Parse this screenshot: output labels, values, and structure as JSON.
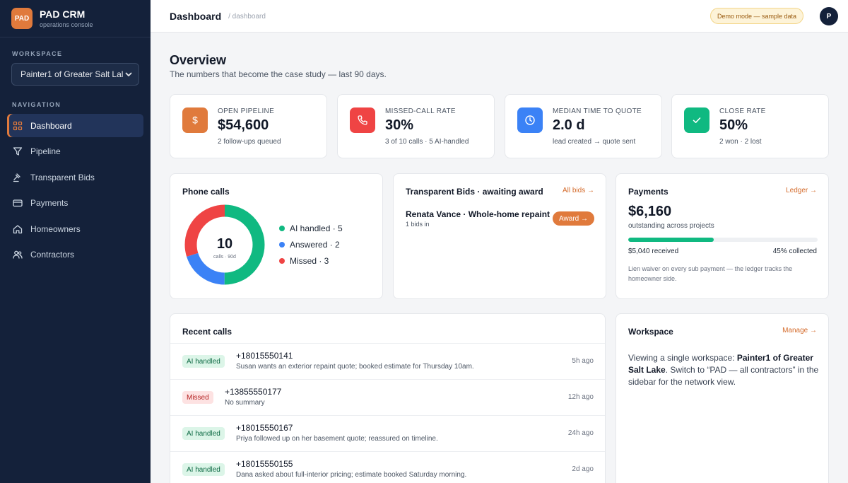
{
  "brand": {
    "logo": "PAD",
    "name": "PAD CRM",
    "subtitle": "operations console"
  },
  "sidebar": {
    "workspace_label": "WORKSPACE",
    "workspace_value": "Painter1 of Greater Salt Lal",
    "nav_label": "NAVIGATION",
    "items": [
      {
        "label": "Dashboard",
        "icon": "grid-icon",
        "active": true
      },
      {
        "label": "Pipeline",
        "icon": "funnel-icon"
      },
      {
        "label": "Transparent Bids",
        "icon": "gavel-icon"
      },
      {
        "label": "Payments",
        "icon": "credit-card-icon"
      },
      {
        "label": "Homeowners",
        "icon": "home-icon"
      },
      {
        "label": "Contractors",
        "icon": "users-icon"
      }
    ]
  },
  "header": {
    "title": "Dashboard",
    "breadcrumb": "/ dashboard",
    "demo_badge": "Demo mode — sample data",
    "avatar_initial": "P"
  },
  "overview": {
    "title": "Overview",
    "subtitle": "The numbers that become the case study — last 90 days."
  },
  "kpis": [
    {
      "label": "OPEN PIPELINE",
      "value": "$54,600",
      "note": "2 follow-ups queued",
      "icon": "dollar-icon",
      "color": "#e07a3c"
    },
    {
      "label": "MISSED-CALL RATE",
      "value": "30%",
      "note": "3 of 10 calls · 5 AI-handled",
      "icon": "phone-icon",
      "color": "#ef4444"
    },
    {
      "label": "MEDIAN TIME TO QUOTE",
      "value": "2.0 d",
      "note": "lead created → quote sent",
      "icon": "clock-icon",
      "color": "#3b82f6"
    },
    {
      "label": "CLOSE RATE",
      "value": "50%",
      "note": "2 won · 2 lost",
      "icon": "check-icon",
      "color": "#10b981"
    }
  ],
  "phone_calls": {
    "title": "Phone calls",
    "total": "10",
    "total_caption": "calls · 90d",
    "legend": [
      {
        "label": "AI handled · 5",
        "color": "#10b981"
      },
      {
        "label": "Answered · 2",
        "color": "#3b82f6"
      },
      {
        "label": "Missed · 3",
        "color": "#ef4444"
      }
    ]
  },
  "chart_data": {
    "type": "pie",
    "categories": [
      "AI handled",
      "Answered",
      "Missed"
    ],
    "values": [
      5,
      2,
      3
    ],
    "colors": [
      "#10b981",
      "#3b82f6",
      "#ef4444"
    ],
    "title": "Phone calls"
  },
  "bids": {
    "title": "Transparent Bids · awaiting award",
    "link": "All bids →",
    "item_name": "Renata Vance · Whole-home repaint",
    "item_sub": "1 bids in",
    "award_label": "Award →"
  },
  "payments": {
    "title": "Payments",
    "link": "Ledger →",
    "value": "$6,160",
    "sub": "outstanding across projects",
    "received": "$5,040 received",
    "collected_label": "45% collected",
    "collected_fraction": 0.45,
    "note": "Lien waiver on every sub payment — the ledger tracks the homeowner side."
  },
  "recent_calls": {
    "title": "Recent calls",
    "rows": [
      {
        "status": "AI handled",
        "type": "ai",
        "number": "+18015550141",
        "summary": "Susan wants an exterior repaint quote; booked estimate for Thursday 10am.",
        "time": "5h ago"
      },
      {
        "status": "Missed",
        "type": "missed",
        "number": "+13855550177",
        "summary": "No summary",
        "time": "12h ago"
      },
      {
        "status": "AI handled",
        "type": "ai",
        "number": "+18015550167",
        "summary": "Priya followed up on her basement quote; reassured on timeline.",
        "time": "24h ago"
      },
      {
        "status": "AI handled",
        "type": "ai",
        "number": "+18015550155",
        "summary": "Dana asked about full-interior pricing; estimate booked Saturday morning.",
        "time": "2d ago"
      }
    ]
  },
  "workspace_card": {
    "title": "Workspace",
    "link": "Manage →",
    "text_1": "Viewing a single workspace: ",
    "text_bold": "Painter1 of Greater Salt Lake",
    "text_2": ". Switch to “PAD — all contractors” in the sidebar for the network view."
  }
}
